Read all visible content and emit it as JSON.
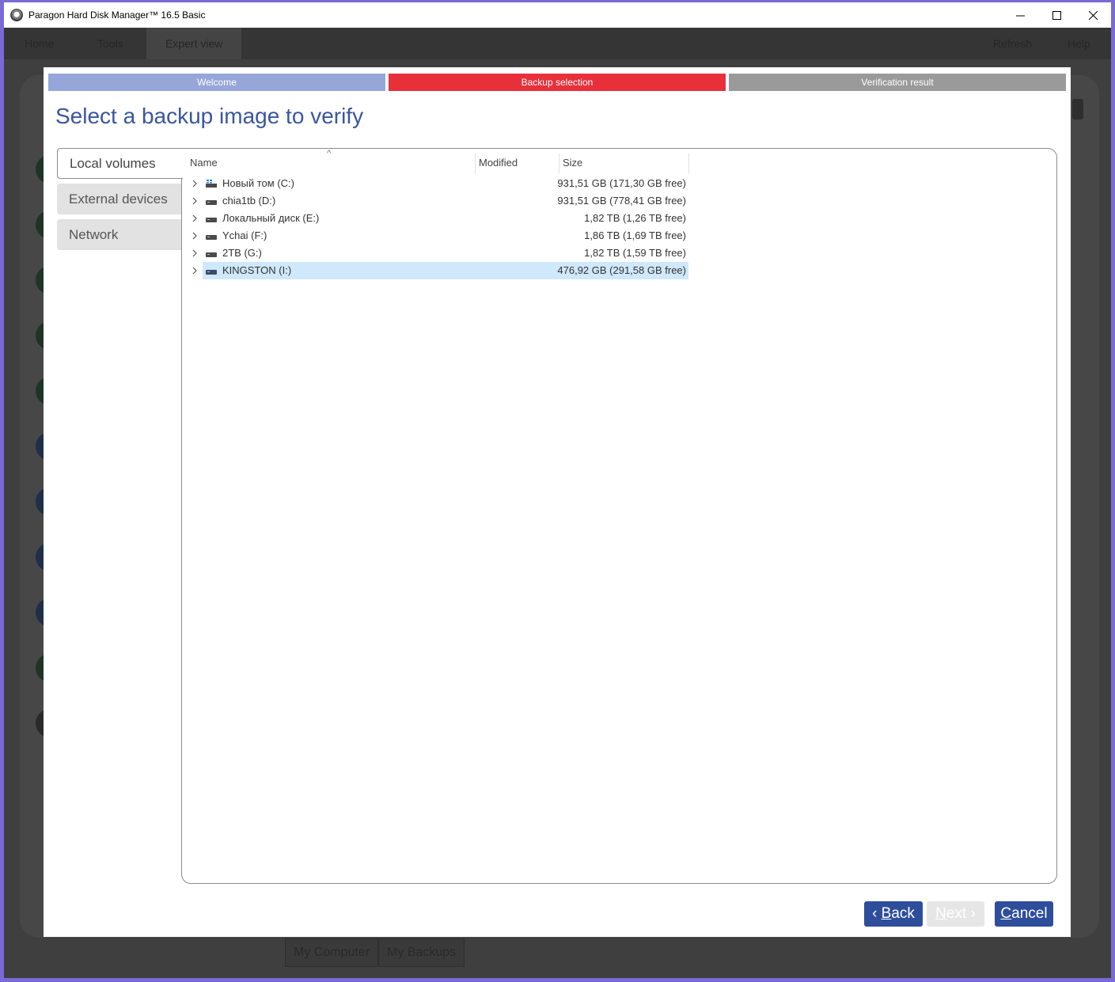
{
  "window": {
    "title": "Paragon Hard Disk Manager™ 16.5 Basic"
  },
  "background": {
    "tabs": [
      "Home",
      "Tools",
      "Expert view"
    ],
    "actions": [
      "Refresh",
      "Help"
    ],
    "bottom_tabs": [
      "My Computer",
      "My Backups"
    ]
  },
  "wizard": {
    "steps": [
      "Welcome",
      "Backup selection",
      "Verification result"
    ],
    "heading": "Select a backup image to verify",
    "sources": [
      "Local volumes",
      "External devices",
      "Network"
    ],
    "columns": {
      "name": "Name",
      "modified": "Modified",
      "size": "Size"
    },
    "volumes": [
      {
        "name": "Новый том (C:)",
        "size": "931,51 GB (171,30 GB free)",
        "icon": "windows-drive-icon"
      },
      {
        "name": "chia1tb (D:)",
        "size": "931,51 GB (778,41 GB free)",
        "icon": "drive-icon"
      },
      {
        "name": "Локальный диск (E:)",
        "size": "1,82 TB (1,26 TB free)",
        "icon": "drive-icon"
      },
      {
        "name": "Ychai (F:)",
        "size": "1,86 TB (1,69 TB free)",
        "icon": "drive-icon"
      },
      {
        "name": "2TB (G:)",
        "size": "1,82 TB (1,59 TB free)",
        "icon": "drive-icon"
      },
      {
        "name": "KINGSTON (I:)",
        "size": "476,92 GB (291,58 GB free)",
        "icon": "usb-drive-icon",
        "selected": true
      }
    ],
    "buttons": {
      "back_prefix": "‹ ",
      "back_key": "B",
      "back_rest": "ack",
      "next_key": "N",
      "next_rest": "ext",
      "next_suffix": " ›",
      "cancel_key": "C",
      "cancel_rest": "ancel"
    }
  },
  "colors": {
    "accent": "#2e4e9c",
    "step_active": "#e8303a",
    "step_done": "#97a6d8",
    "step_pending": "#9a9a9a",
    "selection": "#cfe8fb"
  }
}
